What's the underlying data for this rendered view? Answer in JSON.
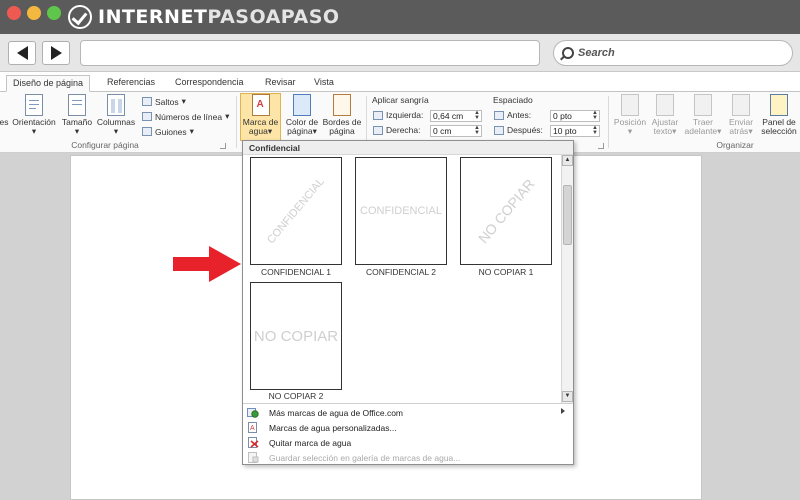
{
  "brand": {
    "part1": "INTERNET",
    "part2": "PASOAPASO"
  },
  "search": {
    "label": "Search"
  },
  "tabs": [
    {
      "label": "Diseño de página",
      "active": true
    },
    {
      "label": "Referencias"
    },
    {
      "label": "Correspondencia"
    },
    {
      "label": "Revisar"
    },
    {
      "label": "Vista"
    }
  ],
  "ribbon": {
    "configurar": {
      "cut_label": "es",
      "orientacion": "Orientación",
      "tamano": "Tamaño",
      "columnas": "Columnas",
      "saltos": "Saltos",
      "numeros_linea": "Números de línea",
      "guiones": "Guiones",
      "group_label": "Configurar página"
    },
    "fondo": {
      "marca_line1": "Marca de",
      "marca_line2": "agua",
      "color_line1": "Color de",
      "color_line2": "página",
      "bordes_line1": "Bordes de",
      "bordes_line2": "página"
    },
    "sangria": {
      "title": "Aplicar sangría",
      "izquierda_label": "Izquierda:",
      "izquierda_value": "0,64 cm",
      "derecha_label": "Derecha:",
      "derecha_value": "0 cm"
    },
    "espaciado": {
      "title": "Espaciado",
      "antes_label": "Antes:",
      "antes_value": "0 pto",
      "despues_label": "Después:",
      "despues_value": "10 pto"
    },
    "organizar": {
      "posicion": "Posición",
      "ajustar_line1": "Ajustar",
      "ajustar_line2": "texto",
      "traer_line1": "Traer",
      "traer_line2": "adelante",
      "enviar_line1": "Enviar",
      "enviar_line2": "atrás",
      "panel_line1": "Panel de",
      "panel_line2": "selección",
      "group_label": "Organizar"
    }
  },
  "gallery": {
    "header": "Confidencial",
    "items": [
      {
        "caption": "CONFIDENCIAL 1",
        "watermark": "CONFIDENCIAL",
        "style": "diagonal"
      },
      {
        "caption": "CONFIDENCIAL 2",
        "watermark": "CONFIDENCIAL",
        "style": "horizontal"
      },
      {
        "caption": "NO COPIAR 1",
        "watermark": "NO COPIAR",
        "style": "diagonal"
      },
      {
        "caption": "NO COPIAR 2",
        "watermark": "NO COPIAR",
        "style": "horizontal"
      }
    ]
  },
  "menu": [
    {
      "label": "Más marcas de agua de Office.com",
      "submenu": true,
      "disabled": false,
      "icon": "globe-icon"
    },
    {
      "label": "Marcas de agua personalizadas...",
      "submenu": false,
      "disabled": false,
      "icon": "custom-watermark-icon"
    },
    {
      "label": "Quitar marca de agua",
      "submenu": false,
      "disabled": false,
      "icon": "remove-watermark-icon"
    },
    {
      "label": "Guardar selección en galería de marcas de agua...",
      "submenu": false,
      "disabled": true,
      "icon": "save-gallery-icon"
    }
  ],
  "colors": {
    "arrow": "#e8222a",
    "highlight": "#fde5a8",
    "titlebar": "#5b5b5b"
  }
}
